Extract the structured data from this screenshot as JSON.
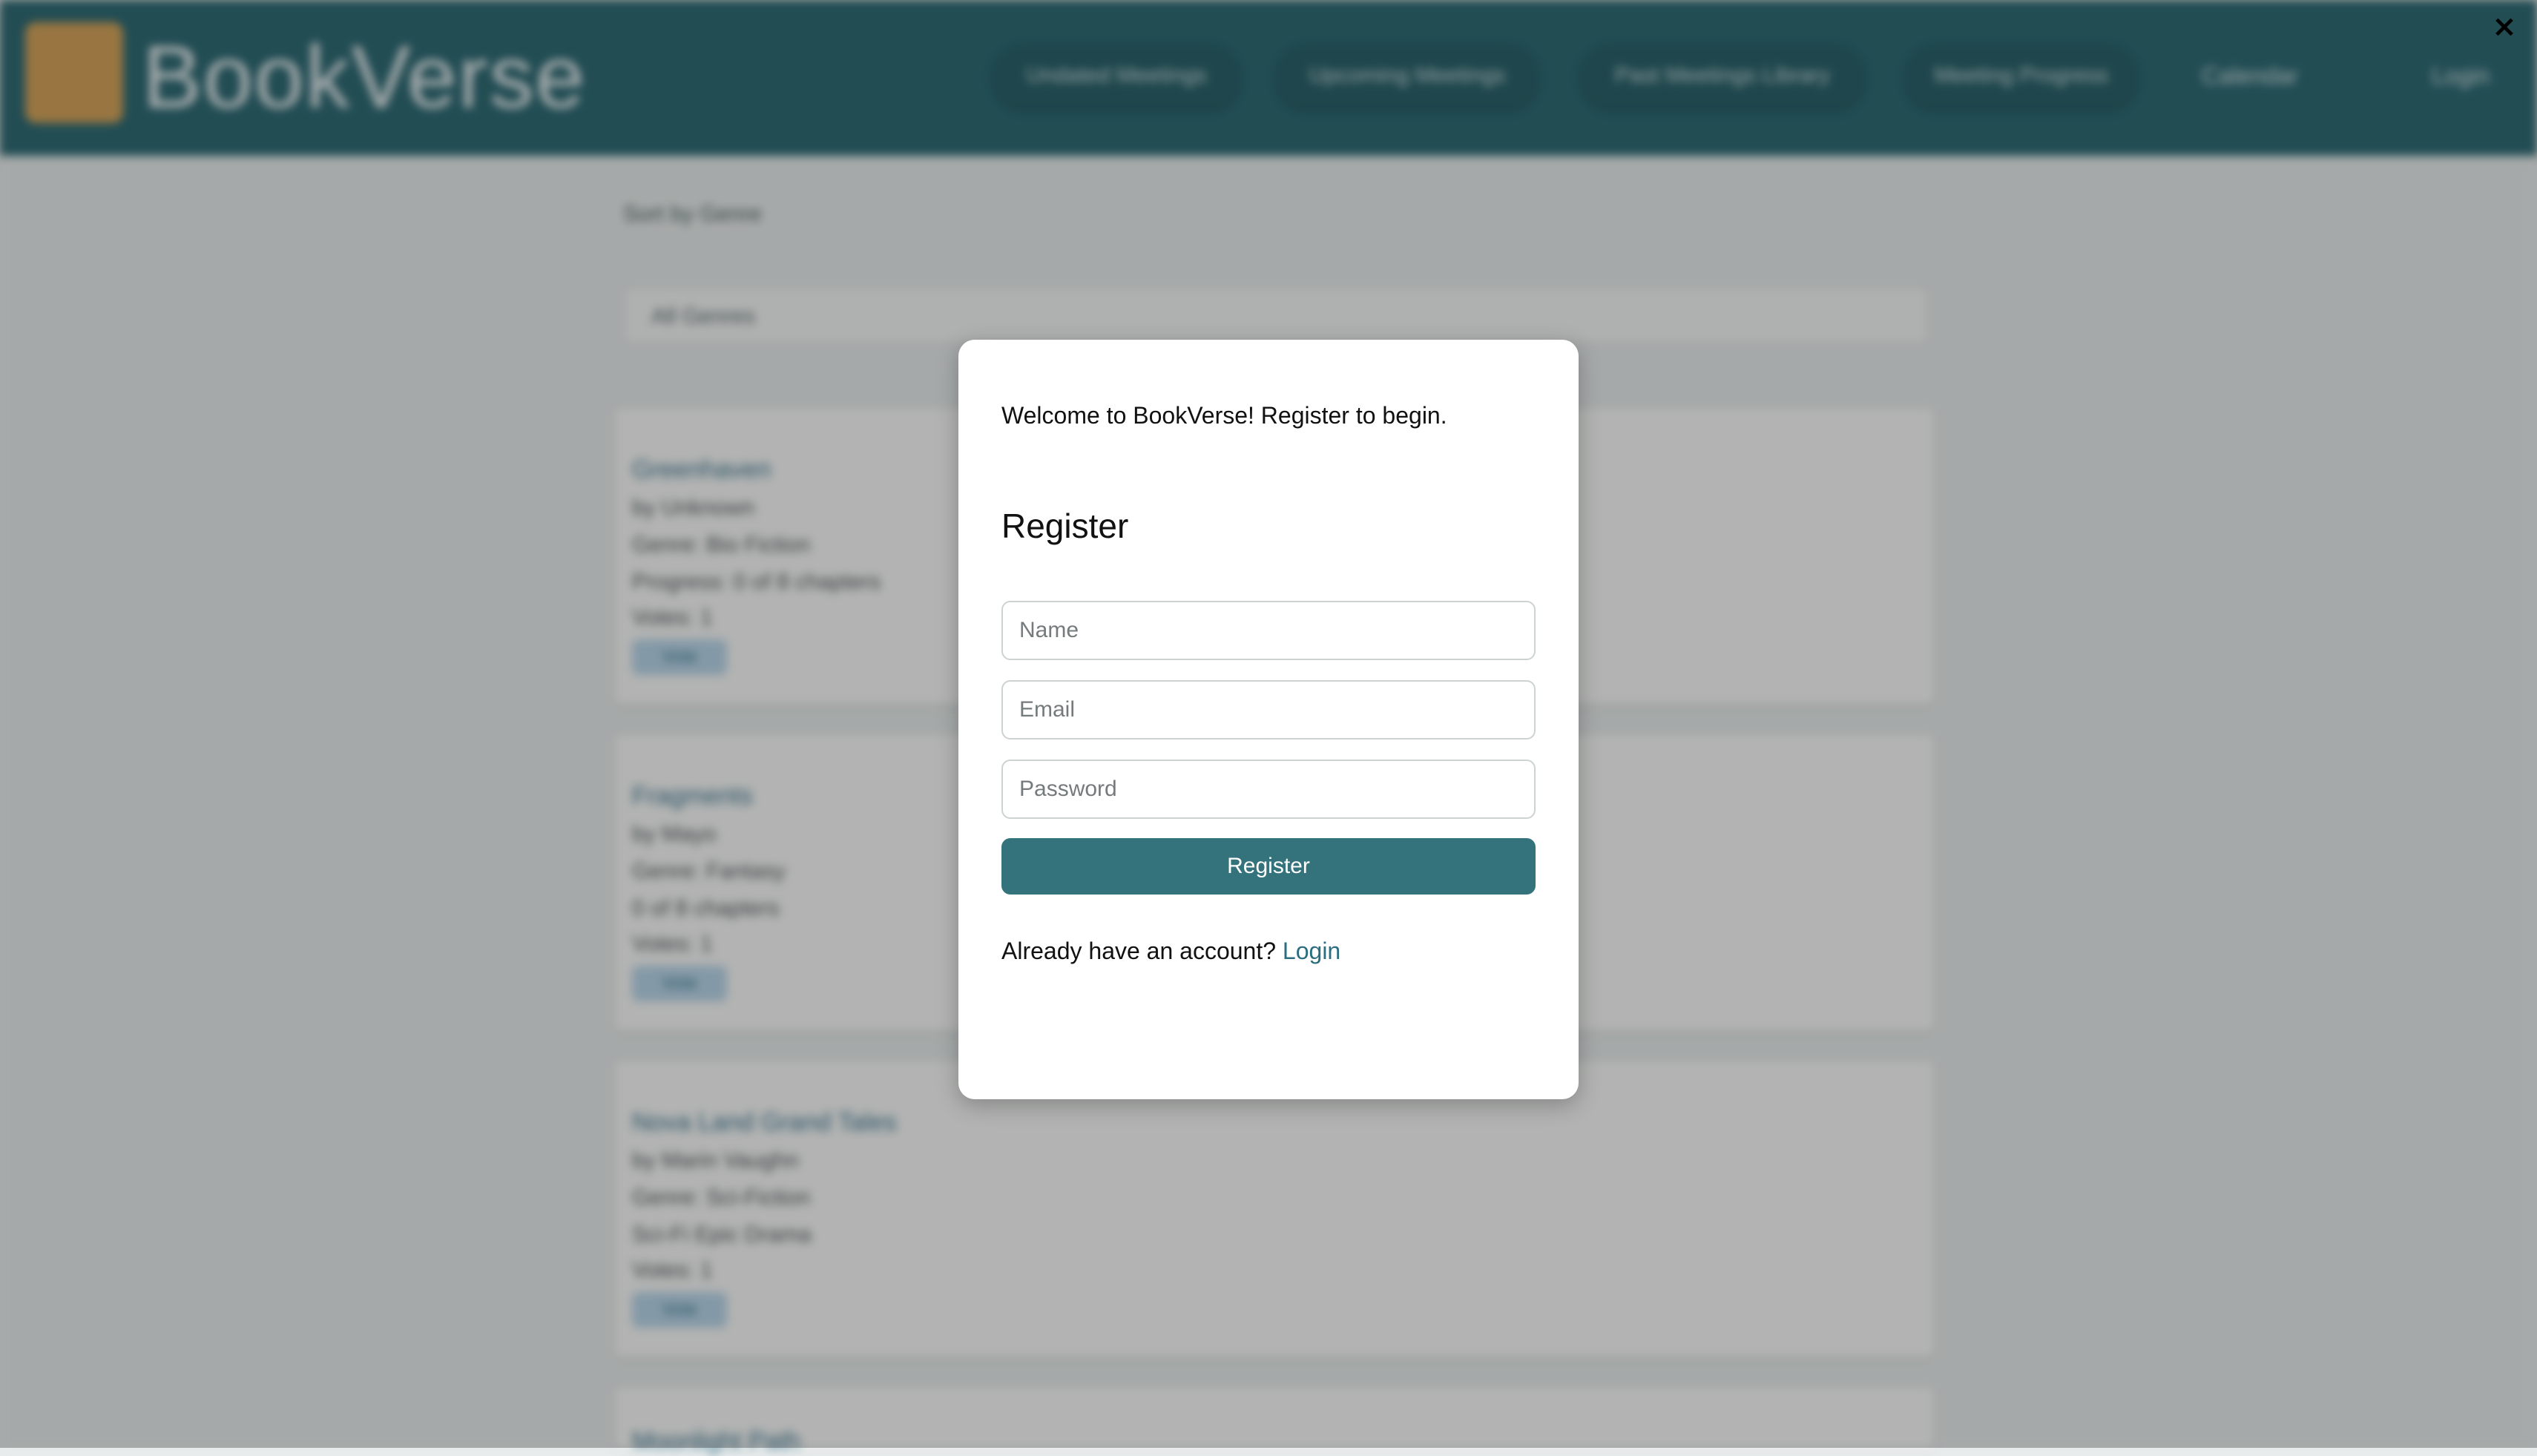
{
  "header": {
    "brand": "BookVerse",
    "nav": [
      "Undated Meetings",
      "Upcoming Meetings",
      "Past Meetings Library",
      "Meeting Progress"
    ],
    "nav_links": [
      "Calendar",
      "Login"
    ]
  },
  "main": {
    "sort_label": "Sort by Genre",
    "filter_value": "All Genres",
    "cards": [
      {
        "title": "Greenhaven",
        "lines": [
          "by Unknown",
          "Genre: Bio Fiction",
          "Progress: 0 of 8 chapters",
          "Votes: 1"
        ],
        "tag": "Vote"
      },
      {
        "title": "Fragments",
        "lines": [
          "by Mayo",
          "Genre: Fantasy",
          "0 of 8 chapters",
          "Votes: 1"
        ],
        "tag": "Vote"
      },
      {
        "title": "Nova Land Grand Tales",
        "lines": [
          "by Marin Vaughn",
          "Genre: Sci-Fiction",
          "Sci-Fi Epic Drama",
          "Votes: 1"
        ],
        "tag": "Vote"
      },
      {
        "title": "Moonlight Path",
        "lines": [],
        "tag": ""
      }
    ]
  },
  "modal": {
    "close_label": "×",
    "welcome": "Welcome to BookVerse! Register to begin.",
    "title": "Register",
    "fields": {
      "name_placeholder": "Name",
      "email_placeholder": "Email",
      "password_placeholder": "Password"
    },
    "submit_label": "Register",
    "login_prompt": "Already have an account?",
    "login_link": "Login"
  },
  "colors": {
    "header_bg": "#2f6b74",
    "accent": "#35737c",
    "link": "#2c6e80",
    "logo": "#d4a45b"
  }
}
